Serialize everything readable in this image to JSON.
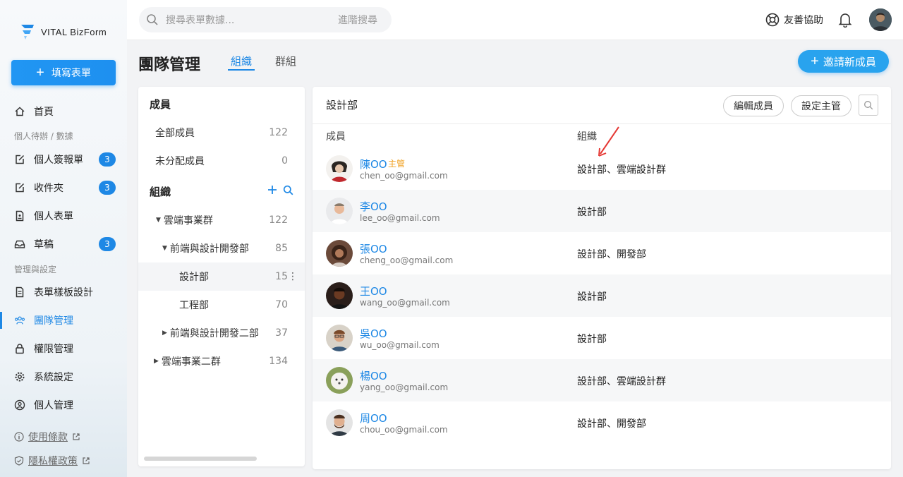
{
  "app": {
    "logo_text": "VITAL BizForm"
  },
  "sidebar": {
    "fill_button": "填寫表單",
    "home": "首頁",
    "section_personal": "個人待辦 / 數據",
    "items": [
      {
        "label": "個人簽報單",
        "badge": "3"
      },
      {
        "label": "收件夾",
        "badge": "3"
      },
      {
        "label": "個人表單",
        "badge": ""
      },
      {
        "label": "草稿",
        "badge": "3"
      }
    ],
    "section_admin": "管理與設定",
    "admin_items": [
      {
        "label": "表單樣板設計"
      },
      {
        "label": "團隊管理"
      },
      {
        "label": "權限管理"
      },
      {
        "label": "系統設定"
      },
      {
        "label": "個人管理"
      }
    ],
    "terms": "使用條款",
    "privacy": "隱私權政策"
  },
  "topbar": {
    "search_placeholder": "搜尋表單數據...",
    "advanced_search": "進階搜尋",
    "help": "友善協助"
  },
  "header": {
    "title": "團隊管理",
    "tabs": [
      "組織",
      "群組"
    ],
    "invite_button": "邀請新成員"
  },
  "left_panel": {
    "members_heading": "成員",
    "all_members": {
      "label": "全部成員",
      "count": "122"
    },
    "unassigned": {
      "label": "未分配成員",
      "count": "0"
    },
    "org_heading": "組織",
    "tree": [
      {
        "label": "雲端事業群",
        "count": "122"
      },
      {
        "label": "前端與設計開發部",
        "count": "85"
      },
      {
        "label": "設計部",
        "count": "15"
      },
      {
        "label": "工程部",
        "count": "70"
      },
      {
        "label": "前端與設計開發二部",
        "count": "37"
      },
      {
        "label": "雲端事業二群",
        "count": "134"
      }
    ]
  },
  "right_panel": {
    "title": "設計部",
    "edit_members": "編輯成員",
    "set_manager": "設定主管",
    "col_member": "成員",
    "col_org": "組織",
    "members": [
      {
        "name": "陳OO",
        "tag": "主管",
        "email": "chen_oo@gmail.com",
        "org": "設計部、雲端設計群"
      },
      {
        "name": "李OO",
        "tag": "",
        "email": "lee_oo@gmail.com",
        "org": "設計部"
      },
      {
        "name": "張OO",
        "tag": "",
        "email": "cheng_oo@gmail.com",
        "org": "設計部、開發部"
      },
      {
        "name": "王OO",
        "tag": "",
        "email": "wang_oo@gmail.com",
        "org": "設計部"
      },
      {
        "name": "吳OO",
        "tag": "",
        "email": "wu_oo@gmail.com",
        "org": "設計部"
      },
      {
        "name": "楊OO",
        "tag": "",
        "email": "yang_oo@gmail.com",
        "org": "設計部、雲端設計群"
      },
      {
        "name": "周OO",
        "tag": "",
        "email": "chou_oo@gmail.com",
        "org": "設計部、開發部"
      }
    ]
  },
  "colors": {
    "accent": "#1e88e5",
    "manager_tag": "#f0a020",
    "arrow": "#e53935"
  }
}
